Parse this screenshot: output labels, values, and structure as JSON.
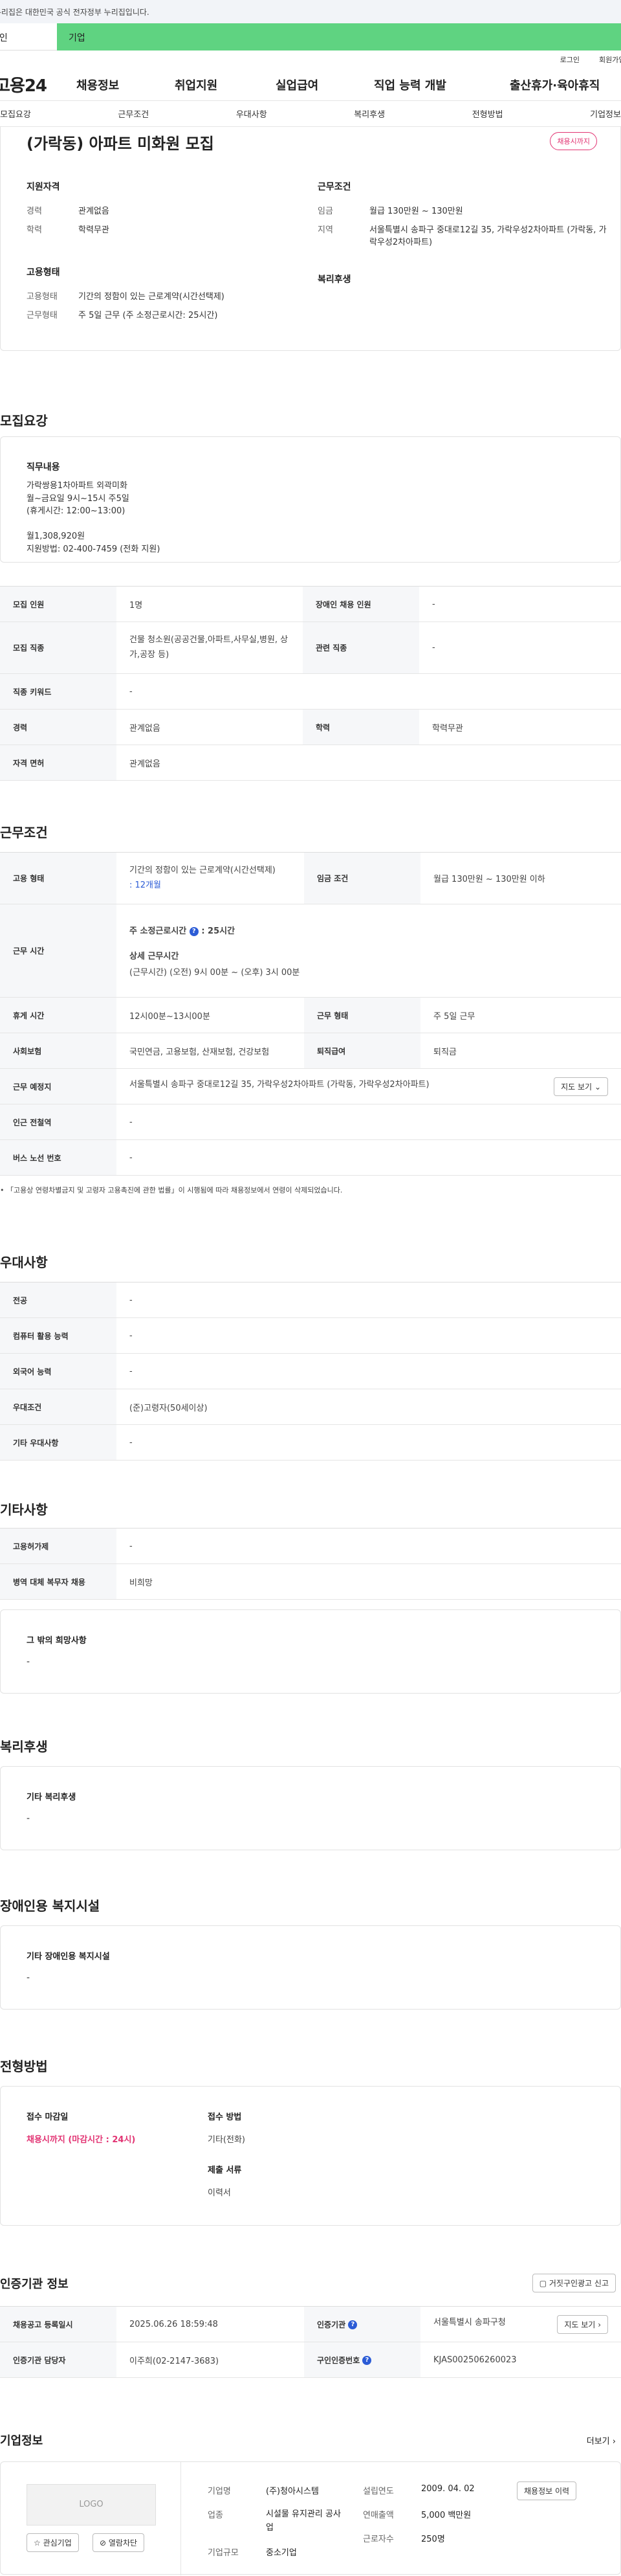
{
  "gov_banner": "이 누리집은 대한민국 공식 전자정부 누리집입니다.",
  "tabs": {
    "person": "개인",
    "corp": "기업"
  },
  "topbar": {
    "login": "로그인",
    "join": "회원가입"
  },
  "gnb": {
    "logo": "고용24",
    "items": [
      "채용정보",
      "취업지원",
      "실업급여",
      "직업 능력 개발",
      "출산휴가·육아휴직"
    ]
  },
  "subnav": [
    "모집요강",
    "근무조건",
    "우대사항",
    "복리후생",
    "전형방법",
    "기업정보"
  ],
  "summary": {
    "title": "(가락동) 아파트 미화원 모집",
    "badge": "채용시까지",
    "qual_title": "지원자격",
    "qual": [
      {
        "k": "경력",
        "v": "관계없음"
      },
      {
        "k": "학력",
        "v": "학력무관"
      }
    ],
    "emp_title": "고용형태",
    "emp": [
      {
        "k": "고용형태",
        "v": "기간의 정함이 있는 근로계약(시간선택제)"
      },
      {
        "k": "근무형태",
        "v": "주 5일 근무 (주 소정근로시간: 25시간)"
      }
    ],
    "cond_title": "근무조건",
    "cond": [
      {
        "k": "임금",
        "v": "월급 130만원 ~ 130만원"
      },
      {
        "k": "지역",
        "v": "서울특별시 송파구 중대로12길 35, 가락우성2차아파트 (가락동, 가락우성2차아파트)"
      }
    ],
    "welfare_title": "복리후생"
  },
  "recruit": {
    "section_title": "모집요강",
    "duty_title": "직무내용",
    "duty_text": "가락쌍용1차아파트 외곽미화\n월~금요일 9시~15시     주5일\n (휴게시간: 12:00~13:00)\n\n월1,308,920원\n지원방법: 02-400-7459 (전화 지원)",
    "rows": [
      [
        "모집 인원",
        "1명",
        "장애인 채용 인원",
        "-"
      ],
      [
        "모집 직종",
        "건물 청소원(공공건물,아파트,사무실,병원, 상가,공장 등)",
        "관련 직종",
        "-"
      ],
      [
        "직종 키워드",
        "-",
        "",
        ""
      ],
      [
        "경력",
        "관계없음",
        "학력",
        "학력무관"
      ],
      [
        "자격 면허",
        "관계없음",
        "",
        ""
      ]
    ]
  },
  "workcond": {
    "section_title": "근무조건",
    "emp_type_label": "고용 형태",
    "emp_type_value": "기간의 정함이 있는 근로계약(시간선택제)",
    "emp_type_link": ": 12개월",
    "wage_label": "임금 조건",
    "wage_value": "월급 130만원 ~ 130만원 이하",
    "hours_label": "근무 시간",
    "hours_weekly": "주 소정근로시간",
    "hours_weekly_value": ": 25시간",
    "hours_detail_title": "상세 근무시간",
    "hours_detail": "(근무시간) (오전) 9시 00분 ~ (오후) 3시 00분",
    "rest_label": "휴게 시간",
    "rest_value": "12시00분~13시00분",
    "shift_label": "근무 형태",
    "shift_value": "주 5일 근무",
    "insurance_label": "사회보험",
    "insurance_value": "국민연금, 고용보험, 산재보험, 건강보험",
    "retire_label": "퇴직급여",
    "retire_value": "퇴직금",
    "place_label": "근무 예정지",
    "place_value": "서울특별시 송파구 중대로12길 35, 가락우성2차아파트 (가락동, 가락우성2차아파트)",
    "map_btn": "지도 보기",
    "subway_label": "인근 전철역",
    "subway_value": "-",
    "bus_label": "버스 노선 번호",
    "bus_value": "-",
    "note": "「고용상 연령차별금지 및 고령자 고용촉진에 관한 법률」이 시행됨에 따라 채용정보에서 연령이 삭제되었습니다."
  },
  "pref": {
    "section_title": "우대사항",
    "rows": [
      [
        "전공",
        "-"
      ],
      [
        "컴퓨터 활용 능력",
        "-"
      ],
      [
        "외국어 능력",
        "-"
      ],
      [
        "우대조건",
        "(준)고령자(50세이상)"
      ],
      [
        "기타 우대사항",
        "-"
      ]
    ]
  },
  "etc": {
    "section_title": "기타사항",
    "rows": [
      [
        "고용허가제",
        "-"
      ],
      [
        "병역 대체 복무자 채용",
        "비희망"
      ]
    ],
    "extra_title": "그 밖의 희망사항",
    "extra_value": "-"
  },
  "welfare": {
    "section_title": "복리후생",
    "box_title": "기타 복리후생",
    "box_value": "-"
  },
  "disabled": {
    "section_title": "장애인용 복지시설",
    "box_title": "기타 장애인용 복지시설",
    "box_value": "-"
  },
  "select": {
    "section_title": "전형방법",
    "deadline_title": "접수 마감일",
    "deadline_value": "채용시까지 (마감시간 : 24시)",
    "method_title": "접수 방법",
    "method_value": "기타(전화)",
    "docs_title": "제출 서류",
    "docs_value": "이력서"
  },
  "cert": {
    "section_title": "인증기관 정보",
    "report_btn": "거짓구인광고 신고",
    "rows": [
      {
        "k1": "채용공고 등록일시",
        "v1": "2025.06.26 18:59:48",
        "k2": "인증기관",
        "v2": "서울특별시 송파구청",
        "btn": "지도 보기"
      },
      {
        "k1": "인증기관 담당자",
        "v1": "이주희(02-2147-3683)",
        "k2": "구인인증번호",
        "v2": "KJAS002506260023",
        "btn": ""
      }
    ]
  },
  "company": {
    "section_title": "기업정보",
    "more": "더보기",
    "logo": "LOGO",
    "fav_btn": "관심기업",
    "block_btn": "열람차단",
    "fields": [
      {
        "k": "기업명",
        "v": "(주)청아시스템"
      },
      {
        "k": "업종",
        "v": "시설물 유지관리 공사업"
      },
      {
        "k": "기업규모",
        "v": "중소기업"
      }
    ],
    "fields2": [
      {
        "k": "설립연도",
        "v": "2009. 04. 02"
      },
      {
        "k": "연매출액",
        "v": "5,000 백만원"
      },
      {
        "k": "근로자수",
        "v": "250명"
      }
    ],
    "history_btn": "채용정보 이력"
  }
}
